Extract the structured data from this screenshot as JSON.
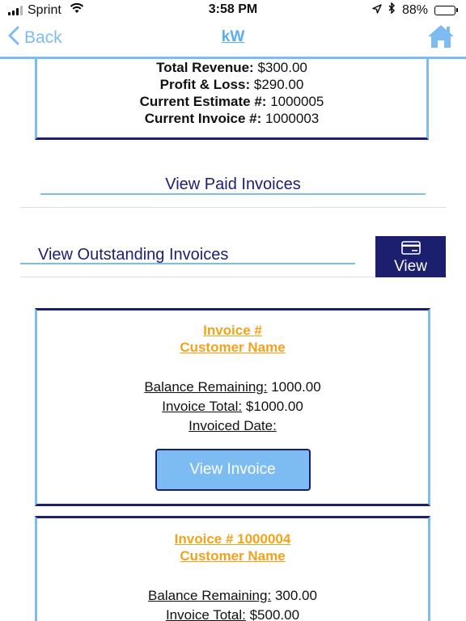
{
  "status_bar": {
    "carrier": "Sprint",
    "time": "3:58 PM",
    "battery": "88%",
    "battery_level": 0.88
  },
  "nav": {
    "back_label": "Back",
    "title": "kW"
  },
  "summary": {
    "total_revenue_label": "Total Revenue:",
    "total_revenue_value": "$300.00",
    "profit_loss_label": "Profit & Loss:",
    "profit_loss_value": "$290.00",
    "current_estimate_label": "Current Estimate #:",
    "current_estimate_value": "1000005",
    "current_invoice_label": "Current Invoice #:",
    "current_invoice_value": "1000003"
  },
  "paid_invoices_link": "View Paid Invoices",
  "outstanding_invoices_link": "View Outstanding Invoices",
  "view_button_label": "View",
  "invoices": [
    {
      "title": "Invoice #",
      "customer": "Customer Name",
      "balance_label": "Balance Remaining:",
      "balance_value": "1000.00",
      "total_label": "Invoice Total:",
      "total_value": "$1000.00",
      "date_label": "Invoiced Date:",
      "button_label": "View Invoice"
    },
    {
      "title": "Invoice # 1000004",
      "customer": "Customer Name",
      "balance_label": "Balance Remaining:",
      "balance_value": "300.00",
      "total_label": "Invoice Total:",
      "total_value": "$500.00"
    }
  ],
  "colors": {
    "accent_light_blue": "#7dbcf3",
    "navy": "#1c1f6e",
    "orange": "#f5a21a"
  },
  "icons": [
    "signal-icon",
    "wifi-icon",
    "location-arrow-icon",
    "bluetooth-icon",
    "battery-icon",
    "chevron-left-icon",
    "home-icon",
    "credit-card-icon"
  ]
}
